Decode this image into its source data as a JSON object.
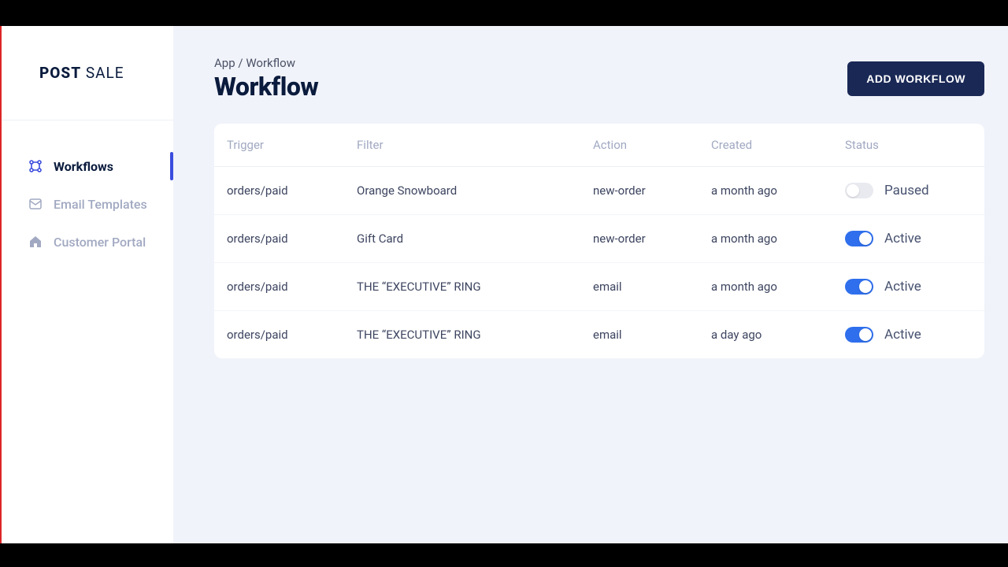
{
  "logo": {
    "part1": "POST",
    "part2": "SALE"
  },
  "sidebar": {
    "items": [
      {
        "label": "Workflows",
        "active": true
      },
      {
        "label": "Email Templates",
        "active": false
      },
      {
        "label": "Customer Portal",
        "active": false
      }
    ]
  },
  "breadcrumb": {
    "root": "App",
    "sep": "/",
    "current": "Workflow"
  },
  "page_title": "Workflow",
  "add_button": "ADD WORKFLOW",
  "table": {
    "headers": {
      "trigger": "Trigger",
      "filter": "Filter",
      "action": "Action",
      "created": "Created",
      "status": "Status"
    },
    "rows": [
      {
        "trigger": "orders/paid",
        "filter": "Orange Snowboard",
        "action": "new-order",
        "created": "a month ago",
        "status": "Paused",
        "on": false
      },
      {
        "trigger": "orders/paid",
        "filter": "Gift Card",
        "action": "new-order",
        "created": "a month ago",
        "status": "Active",
        "on": true
      },
      {
        "trigger": "orders/paid",
        "filter": "THE “EXECUTIVE” RING",
        "action": "email",
        "created": "a month ago",
        "status": "Active",
        "on": true
      },
      {
        "trigger": "orders/paid",
        "filter": "THE “EXECUTIVE” RING",
        "action": "email",
        "created": "a day ago",
        "status": "Active",
        "on": true
      }
    ]
  }
}
